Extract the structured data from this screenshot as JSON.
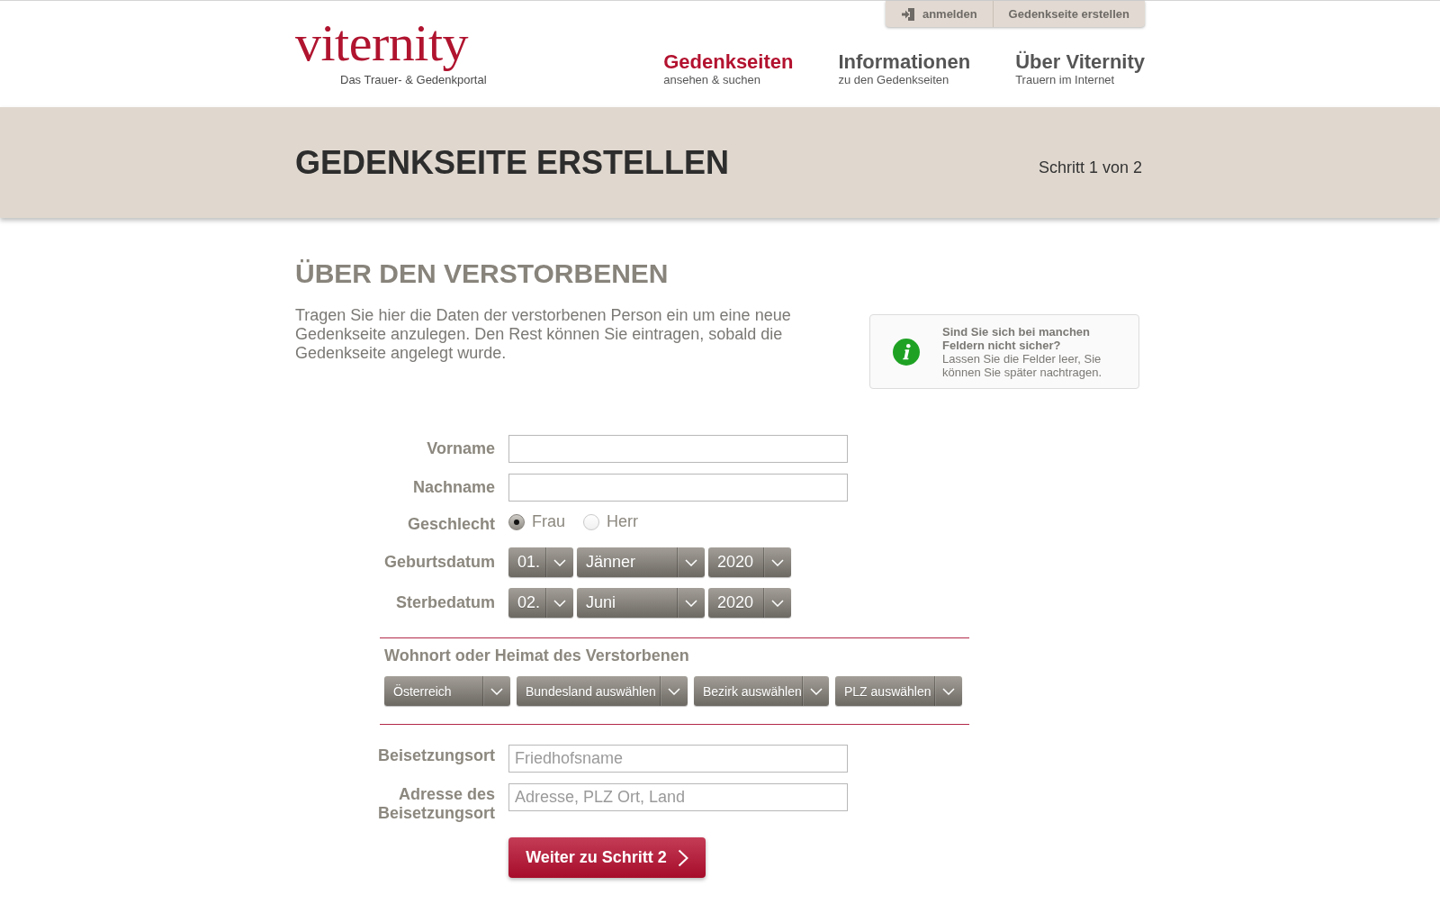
{
  "header": {
    "logo": {
      "wordmark": "viternity",
      "tagline": "Das Trauer- & Gedenkportal"
    },
    "top_links": [
      {
        "kind": "login",
        "label": "anmelden"
      },
      {
        "kind": "link",
        "label": "Gedenkseite erstellen"
      }
    ],
    "nav": [
      {
        "title": "Gedenkseiten",
        "subtitle": "ansehen & suchen",
        "selected": true
      },
      {
        "title": "Informationen",
        "subtitle": "zu den Gedenkseiten",
        "selected": false
      },
      {
        "title": "Über Viternity",
        "subtitle": "Trauern im Internet",
        "selected": false
      }
    ]
  },
  "banner": {
    "title": "GEDENKSEITE ERSTELLEN",
    "step": "Schritt 1 von 2"
  },
  "section": {
    "heading": "ÜBER DEN VERSTORBENEN",
    "intro": "Tragen Sie hier die Daten der verstorbenen Person ein um eine neue Gedenkseite anzulegen. Den Rest können Sie eintragen, sobald die Gedenkseite angelegt wurde.",
    "info": {
      "title": "Sind Sie sich bei manchen Feldern nicht sicher?",
      "text": "Lassen Sie die Felder leer, Sie können Sie später nachtragen."
    }
  },
  "form": {
    "person_fields": [
      {
        "kind": "text",
        "label": "Vorname"
      },
      {
        "kind": "text",
        "label": "Nachname"
      },
      {
        "kind": "radio",
        "label": "Geschlecht",
        "options": [
          {
            "label": "Frau",
            "selected": true
          },
          {
            "label": "Herr",
            "selected": false
          }
        ]
      },
      {
        "kind": "date",
        "label": "Geburtsdatum",
        "day": "01.",
        "month": "Jänner",
        "year": "2020"
      },
      {
        "kind": "date",
        "label": "Sterbedatum",
        "day": "02.",
        "month": "Juni",
        "year": "2020"
      }
    ],
    "residence": {
      "heading": "Wohnort oder Heimat des Verstorbenen",
      "selects": [
        "Österreich",
        "Bundesland auswählen",
        "Bezirk auswählen",
        "PLZ auswählen"
      ]
    },
    "burial_fields": [
      {
        "label": "Beisetzungsort",
        "placeholder": "Friedhofsname"
      },
      {
        "label": "Adresse des Beisetzungsort",
        "placeholder": "Adresse, PLZ Ort, Land"
      }
    ],
    "submit": "Weiter zu Schritt 2"
  }
}
